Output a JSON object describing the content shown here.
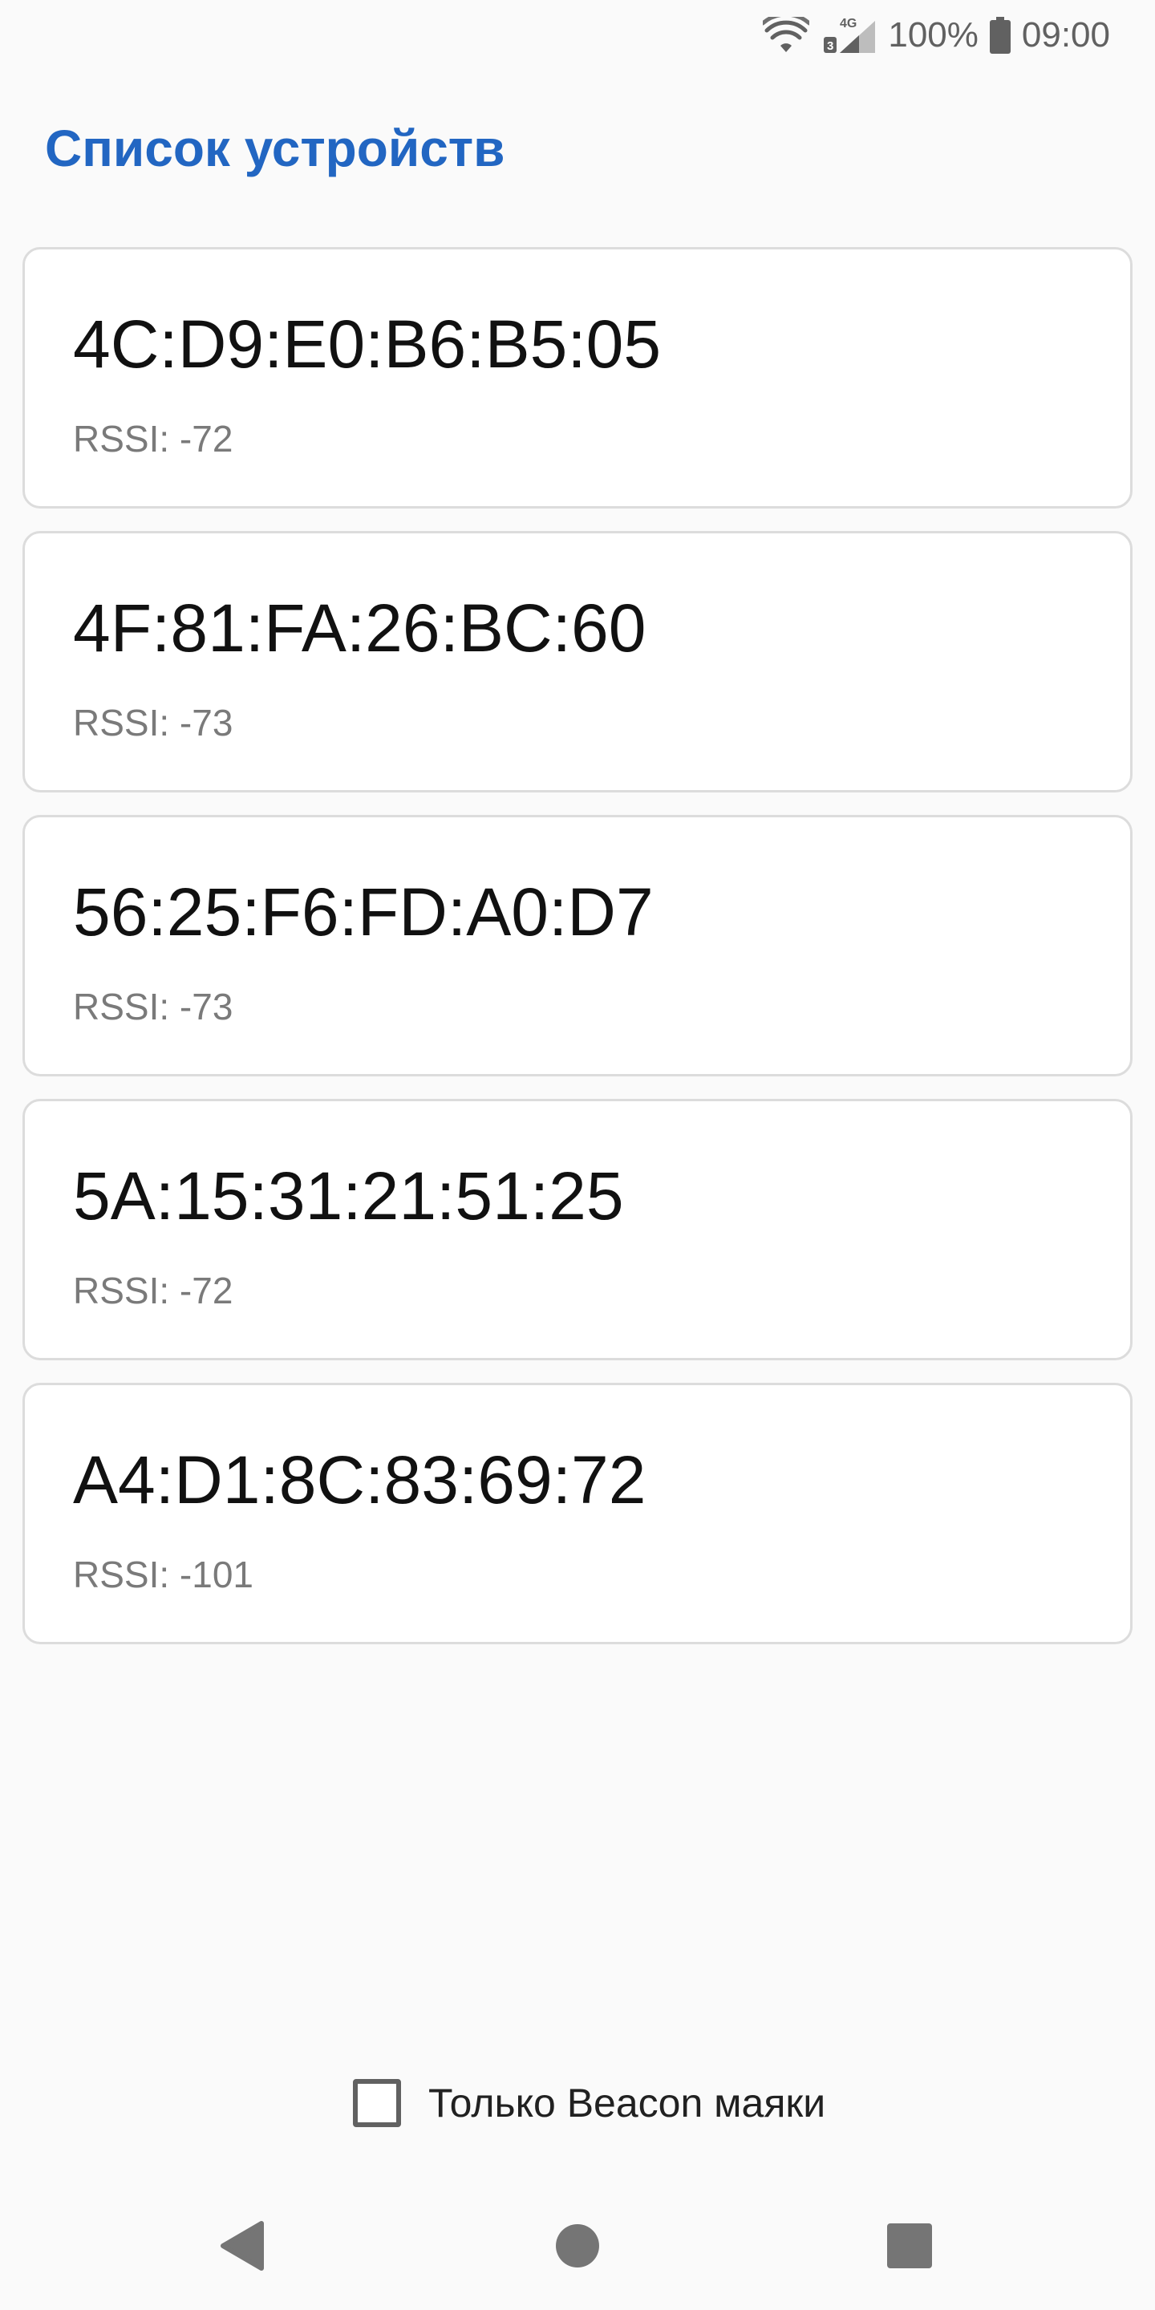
{
  "status_bar": {
    "network_type": "4G",
    "sim_slot": "3",
    "battery_percent": "100%",
    "time": "09:00",
    "icons": [
      "wifi-icon",
      "cell-signal-icon",
      "battery-icon"
    ]
  },
  "header": {
    "title": "Список устройств"
  },
  "devices": [
    {
      "address": "4C:D9:E0:B6:B5:05",
      "rssi": "RSSI: -72"
    },
    {
      "address": "4F:81:FA:26:BC:60",
      "rssi": "RSSI: -73"
    },
    {
      "address": "56:25:F6:FD:A0:D7",
      "rssi": "RSSI: -73"
    },
    {
      "address": "5A:15:31:21:51:25",
      "rssi": "RSSI: -72"
    },
    {
      "address": "A4:D1:8C:83:69:72",
      "rssi": "RSSI: -101"
    }
  ],
  "filter": {
    "label": "Только Beacon маяки",
    "checked": false
  },
  "nav_bar": {
    "icons": [
      "back-icon",
      "home-icon",
      "recents-icon"
    ]
  },
  "colors": {
    "accent": "#2266c2",
    "background": "#fafafa",
    "card_border": "#dcdcdc",
    "secondary_text": "#7a7a7a"
  }
}
